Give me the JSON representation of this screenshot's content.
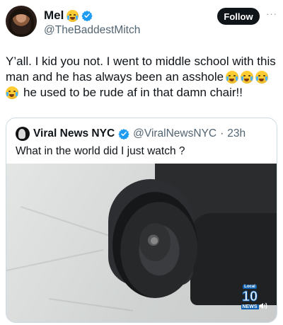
{
  "author": {
    "display_name": "Mel",
    "handle": "@TheBaddestMitch",
    "follow_label": "Follow",
    "more_label": "···"
  },
  "post": {
    "line1": "Y’all. I kid you not. I went to middle school with this",
    "line2": "man and he has always been an asshole",
    "line3": "he used to be rude af in that damn chair!!"
  },
  "quote": {
    "display_name": "Viral News NYC",
    "handle": "@ViralNewsNYC",
    "separator": "·",
    "time": "23h",
    "text": "What in the world did I just watch ?",
    "video_badge": {
      "top": "Local",
      "number": "10",
      "bottom": "NEWS"
    }
  },
  "colors": {
    "verified": "#1d9bf0",
    "text_primary": "#0f1419",
    "text_secondary": "#536471",
    "follow_bg": "#0f1419"
  },
  "icons": [
    "verified-badge-icon",
    "crying-face-emoji",
    "more-icon",
    "speaker-icon"
  ]
}
